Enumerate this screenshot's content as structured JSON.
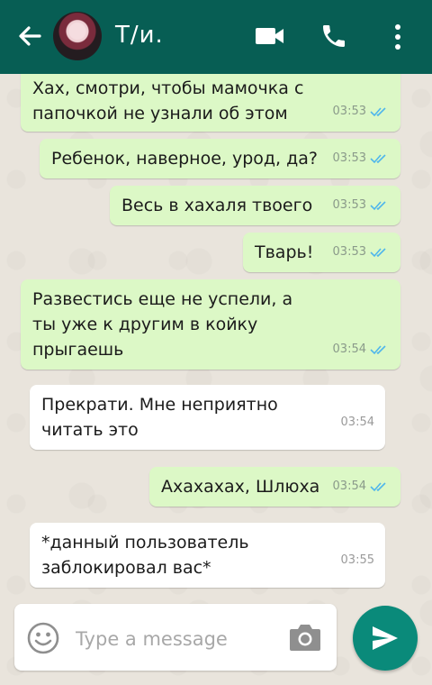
{
  "header": {
    "contact_name": "Т/и.",
    "background_color": "#075e54",
    "icons": [
      "arrow-back-icon",
      "avatar",
      "video-camera-icon",
      "phone-icon",
      "more-vert-icon"
    ]
  },
  "messages": [
    {
      "direction": "out",
      "lines": [
        "Хах, смотри, чтобы мамочка с",
        "папочкой не узнали об этом"
      ],
      "time": "03:53",
      "status": "read"
    },
    {
      "direction": "out",
      "lines": [
        "Ребенок, наверное, урод, да?"
      ],
      "time": "03:53",
      "status": "read"
    },
    {
      "direction": "out",
      "lines": [
        "Весь в хахаля твоего"
      ],
      "time": "03:53",
      "status": "read"
    },
    {
      "direction": "out",
      "lines": [
        "Тварь!"
      ],
      "time": "03:53",
      "status": "read"
    },
    {
      "direction": "out",
      "lines": [
        "Развестись еще не успели, а",
        "ты уже к другим в койку",
        "прыгаешь"
      ],
      "time": "03:54",
      "status": "read"
    },
    {
      "direction": "in",
      "lines": [
        "Прекрати. Мне неприятно",
        "читать это"
      ],
      "time": "03:54"
    },
    {
      "direction": "out",
      "lines": [
        "Ахахахах, Шлюха"
      ],
      "time": "03:54",
      "status": "read"
    },
    {
      "direction": "in",
      "lines": [
        "*данный пользователь",
        "заблокировал вас*"
      ],
      "time": "03:55"
    }
  ],
  "composer": {
    "placeholder": "Type a message"
  },
  "colors": {
    "outgoing_bubble": "#dcf8c6",
    "incoming_bubble": "#ffffff",
    "read_ticks": "#4fb6ec",
    "send_button": "#0a8a7a"
  }
}
